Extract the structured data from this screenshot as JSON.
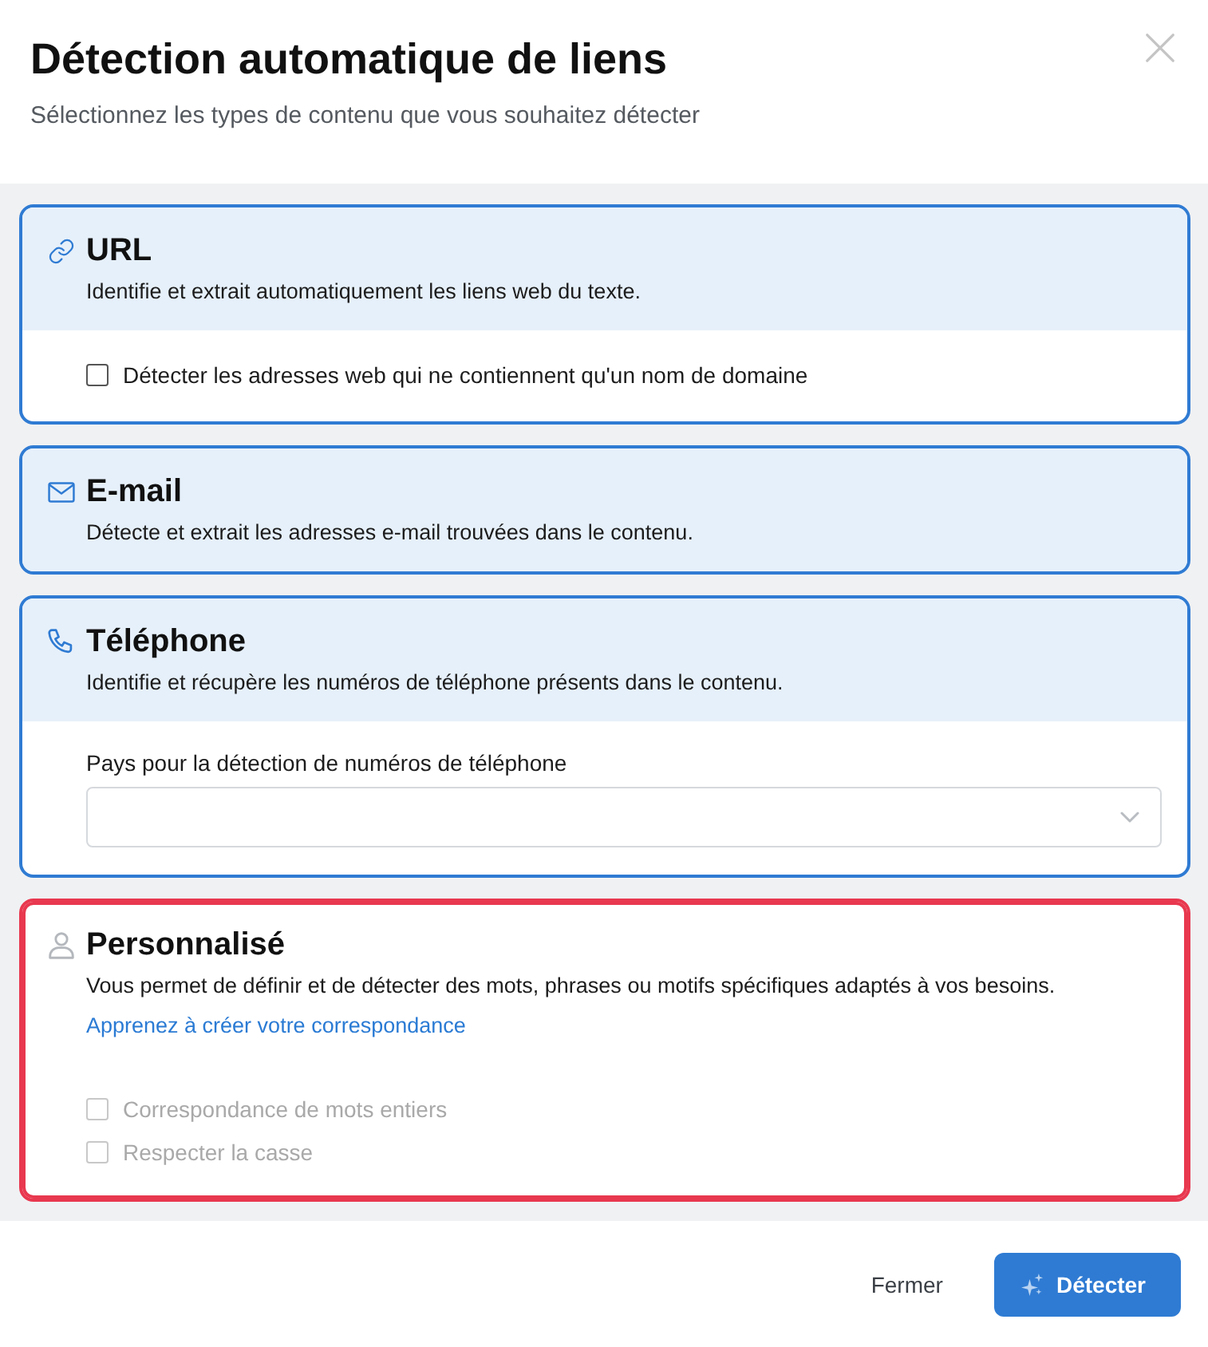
{
  "dialog": {
    "title": "Détection automatique de liens",
    "subtitle": "Sélectionnez les types de contenu que vous souhaitez détecter"
  },
  "cards": [
    {
      "kind": "url",
      "title": "URL",
      "description": "Identifie et extrait automatiquement les liens web du texte.",
      "selected": true,
      "focused": false,
      "options": [
        {
          "label": "Détecter les adresses web qui ne contiennent qu'un nom de domaine",
          "checked": false,
          "disabled": false
        }
      ]
    },
    {
      "kind": "email",
      "title": "E-mail",
      "description": "Détecte et extrait les adresses e-mail trouvées dans le contenu.",
      "selected": true,
      "focused": false
    },
    {
      "kind": "phone",
      "title": "Téléphone",
      "description": "Identifie et récupère les numéros de téléphone présents dans le contenu.",
      "selected": true,
      "focused": false,
      "select": {
        "label": "Pays pour la détection de numéros de téléphone"
      }
    },
    {
      "kind": "custom",
      "title": "Personnalisé",
      "description": "Vous permet de définir et de détecter des mots, phrases ou motifs spécifiques adaptés à vos besoins.",
      "link": "Apprenez à créer votre correspondance",
      "selected": false,
      "focused": true,
      "options": [
        {
          "label": "Correspondance de mots entiers",
          "checked": false,
          "disabled": true
        },
        {
          "label": "Respecter la casse",
          "checked": false,
          "disabled": true
        }
      ]
    }
  ],
  "footer": {
    "buttons": [
      {
        "kind": "secondary",
        "label": "Fermer"
      },
      {
        "kind": "primary",
        "label": "Détecter"
      }
    ]
  }
}
